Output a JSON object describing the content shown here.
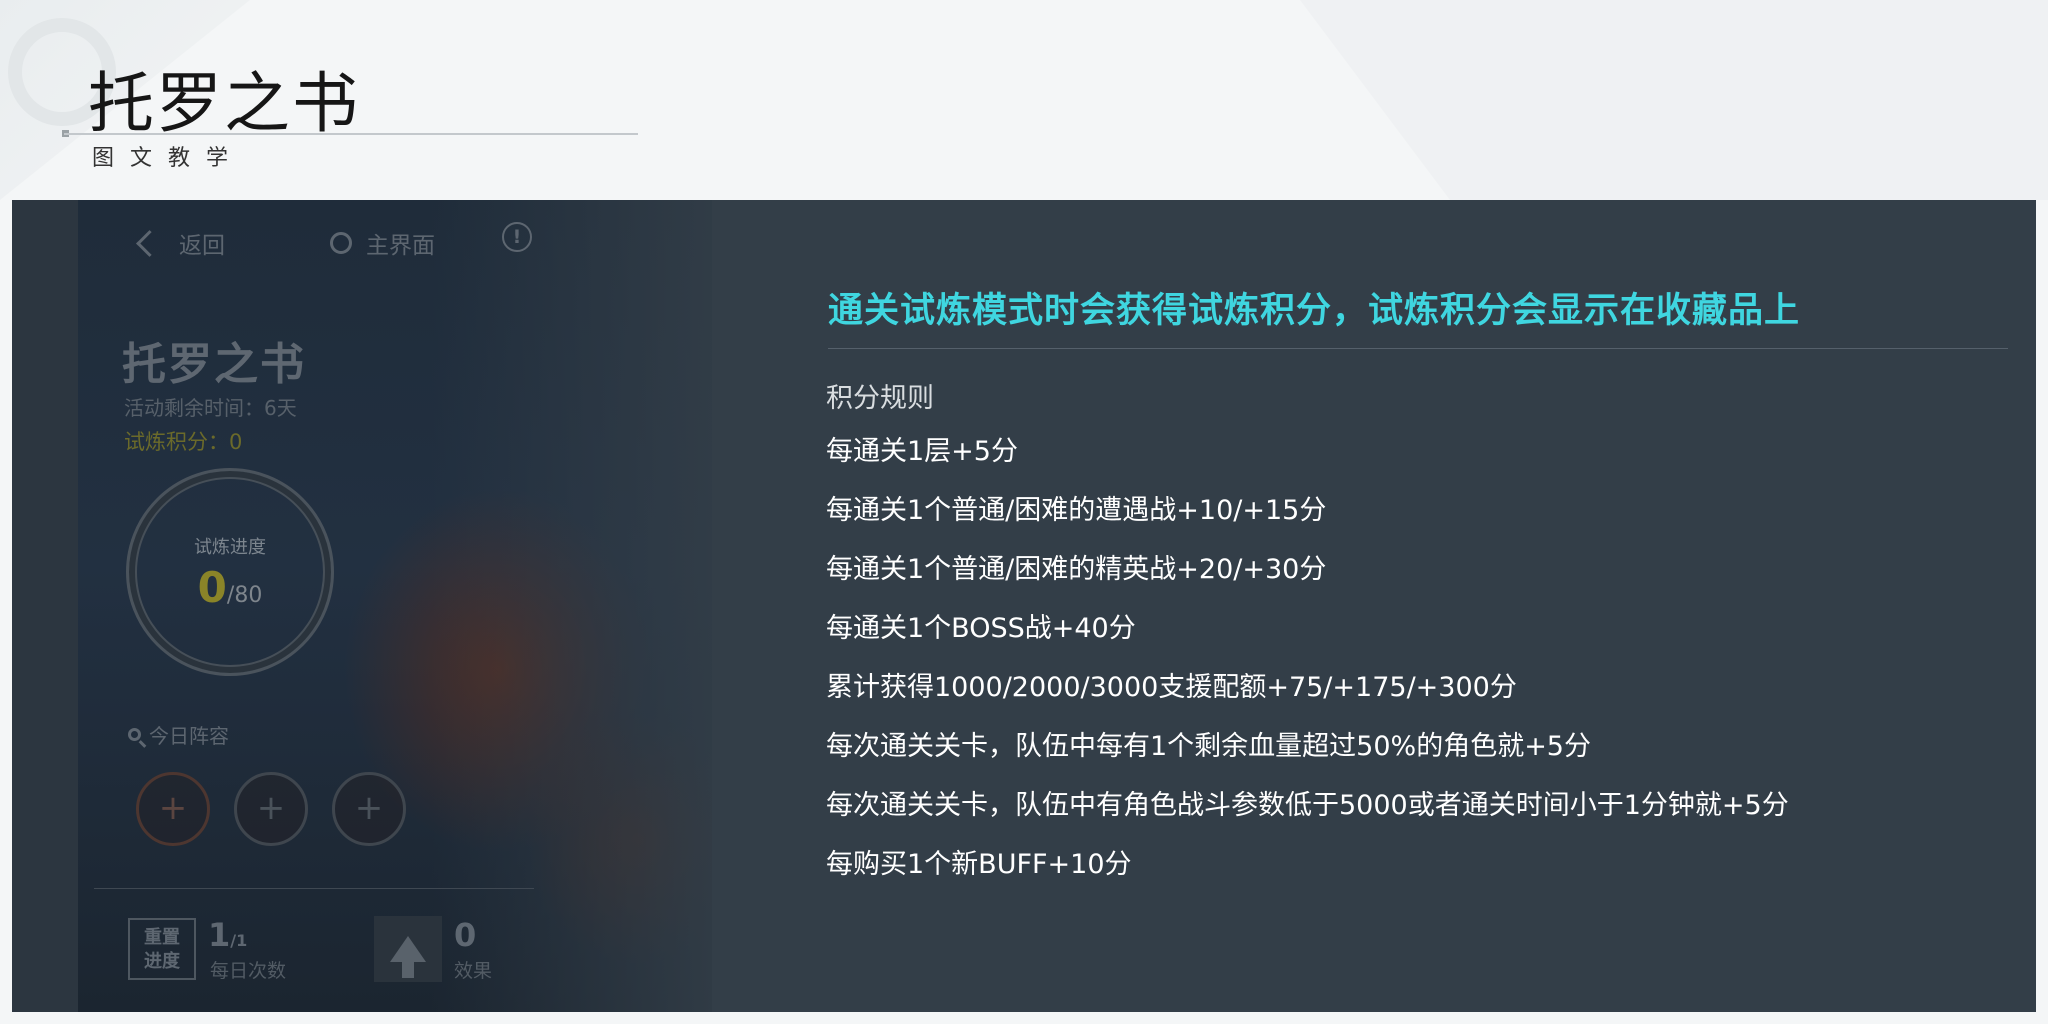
{
  "slide": {
    "title": "托罗之书",
    "subtitle": "图文教学"
  },
  "game": {
    "topbar": {
      "back_label": "返回",
      "home_label": "主界面"
    },
    "title": "托罗之书",
    "remaining_time": "活动剩余时间：6天",
    "score": "试炼积分：0",
    "progress": {
      "label": "试炼进度",
      "current": "0",
      "total": "/80"
    },
    "lineup_label": "今日阵容",
    "slot_symbol": "+",
    "reset": {
      "badge_line1": "重置",
      "badge_line2": "进度",
      "count": "1",
      "count_max": "/1",
      "label": "每日次数"
    },
    "effect": {
      "value": "0",
      "label": "效果"
    }
  },
  "info": {
    "headline": "通关试炼模式时会获得试炼积分，试炼积分会显示在收藏品上",
    "rules_heading": "积分规则",
    "rules": [
      "每通关1层+5分",
      "每通关1个普通/困难的遭遇战+10/+15分",
      "每通关1个普通/困难的精英战+20/+30分",
      "每通关1个BOSS战+40分",
      "累计获得1000/2000/3000支援配额+75/+175/+300分",
      "每次通关关卡，队伍中每有1个剩余血量超过50%的角色就+5分",
      "每次通关关卡，队伍中有角色战斗参数低于5000或者通关时间小于1分钟就+5分",
      "每购买1个新BUFF+10分"
    ]
  },
  "colors": {
    "headline": "#3fd6e0",
    "panel": "#333e48",
    "score": "#6b6a2a"
  }
}
